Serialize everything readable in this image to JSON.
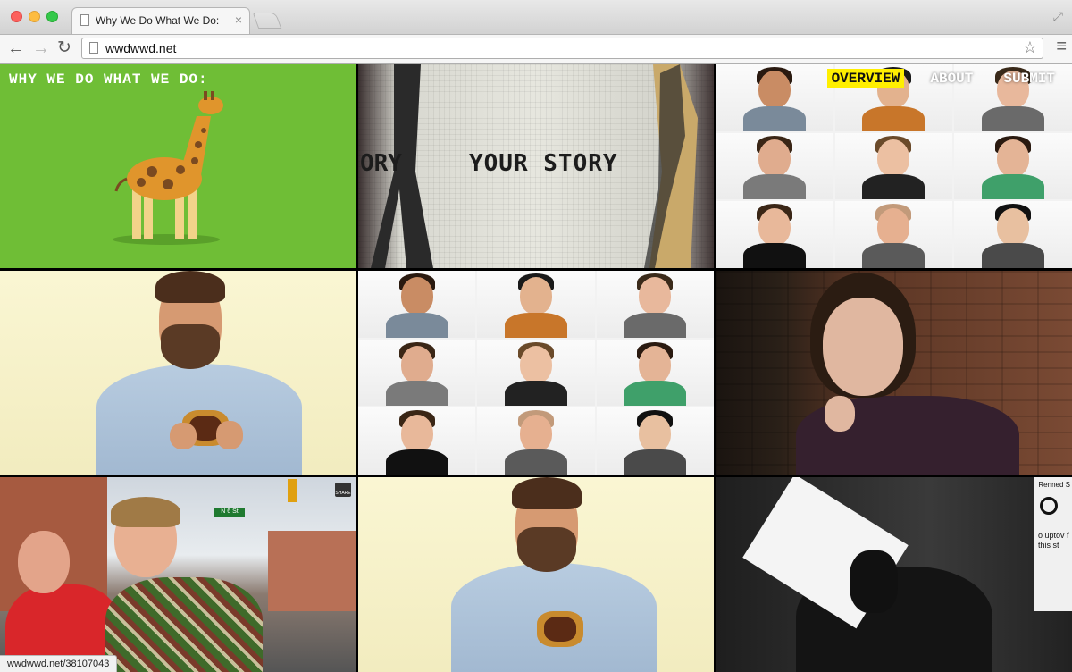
{
  "browser": {
    "tab_title": "Why We Do What We Do:",
    "url": "wwdwwd.net",
    "status_url": "wwdwwd.net/38107043"
  },
  "site": {
    "title": "WHY WE DO WHAT WE DO:",
    "nav": [
      {
        "label": "OVERVIEW",
        "active": true
      },
      {
        "label": "ABOUT",
        "active": false
      },
      {
        "label": "SUBMIT",
        "active": false
      }
    ]
  },
  "tiles": {
    "story_text": "YOUR STORY",
    "story_text_left": "ORY",
    "share_label": "SHARE",
    "street_sign": "N 6 St",
    "poster_heading": "Renned S",
    "poster_lines": "o uptov f this st"
  },
  "colors": {
    "giraffe_bg": "#6fbe36",
    "nav_active_bg": "#ffef00"
  }
}
